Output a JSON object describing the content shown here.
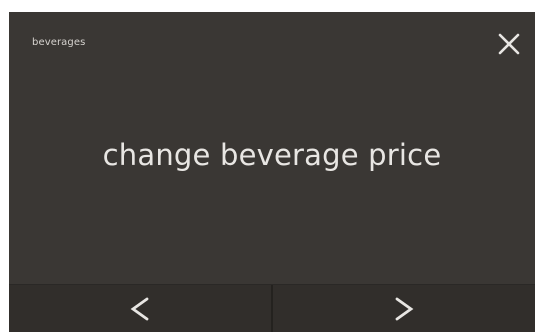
{
  "header": {
    "title": "beverages",
    "close_icon": "close-icon"
  },
  "main": {
    "message": "change beverage price"
  },
  "footer": {
    "prev_icon": "chevron-left-icon",
    "next_icon": "chevron-right-icon"
  },
  "colors": {
    "screen_background": "#3a3734",
    "footer_background": "#312e2b",
    "text": "#e8e6e3"
  }
}
